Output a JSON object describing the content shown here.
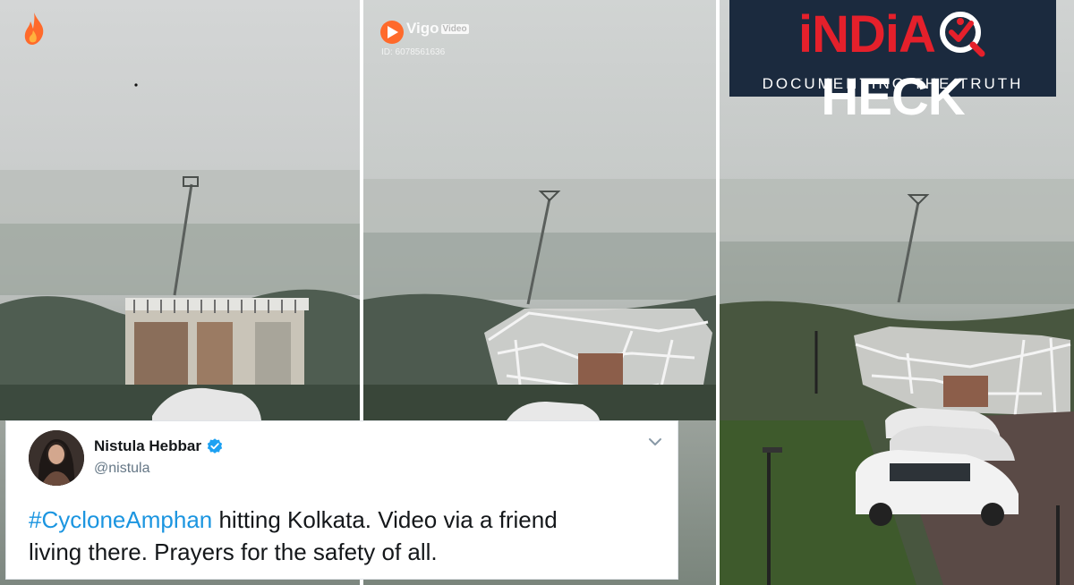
{
  "frames": [
    {
      "name": "video-frame-1",
      "badge": "fire-logo-icon"
    },
    {
      "name": "video-frame-2",
      "badge": "vigo-logo-icon"
    },
    {
      "name": "video-frame-3"
    }
  ],
  "vigo": {
    "name": "Vigo",
    "sub": "Video",
    "id": "ID: 6078561636"
  },
  "logo": {
    "part1": "iNDiA",
    "part2": "HECK",
    "tagline": "DOCUMENTING THE TRUTH",
    "colors": {
      "red": "#e5202b",
      "navy": "#1b2a3e"
    }
  },
  "tweet": {
    "name": "Nistula Hebbar",
    "handle": "@nistula",
    "hashtag": "#CycloneAmphan",
    "text_line1": " hitting Kolkata. Video via a friend",
    "text_line2": "living there. Prayers for the safety of all.",
    "icons": [
      "avatar",
      "verified-badge-icon",
      "chevron-down-icon"
    ],
    "colors": {
      "link": "#1b95e0",
      "text": "#14171a",
      "muted": "#657786"
    }
  }
}
